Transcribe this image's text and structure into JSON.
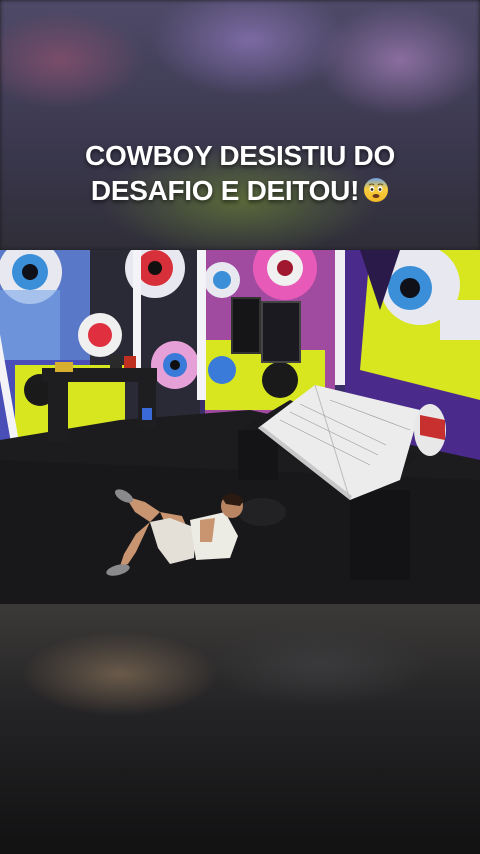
{
  "caption": {
    "line1": "COWBOY DESISTIU DO",
    "line2": "DESAFIO E DEITOU!",
    "emoji": "fearful-face-emoji"
  },
  "video": {
    "scene": "person-lying-on-floor-in-colorful-room"
  },
  "colors": {
    "caption_text": "#ffffff",
    "wall_yellow": "#d8e620",
    "wall_purple": "#5b3bb0",
    "wall_pink": "#d24aa8",
    "floor": "#1c1c1e"
  }
}
